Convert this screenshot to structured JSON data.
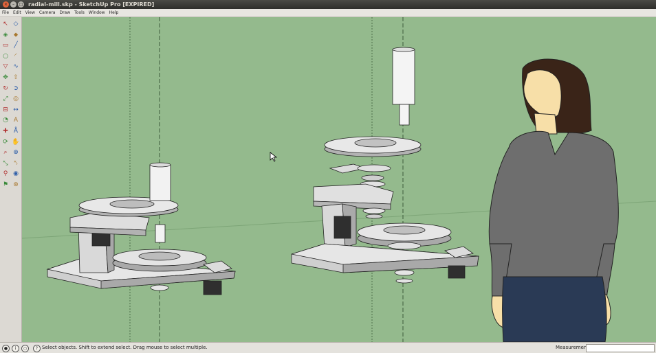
{
  "window": {
    "title": "radial-mill.skp - SketchUp Pro [EXPIRED]"
  },
  "menu": [
    "File",
    "Edit",
    "View",
    "Camera",
    "Draw",
    "Tools",
    "Window",
    "Help"
  ],
  "tools": [
    {
      "icon": "select-arrow-icon",
      "glyph": "↖"
    },
    {
      "icon": "eraser-icon",
      "glyph": "◇"
    },
    {
      "icon": "make-component-icon",
      "glyph": "◈"
    },
    {
      "icon": "paint-bucket-icon",
      "glyph": "⬥"
    },
    {
      "icon": "rectangle-icon",
      "glyph": "▭"
    },
    {
      "icon": "line-pencil-icon",
      "glyph": "╱"
    },
    {
      "icon": "circle-icon",
      "glyph": "○"
    },
    {
      "icon": "arc-icon",
      "glyph": "◜"
    },
    {
      "icon": "polygon-icon",
      "glyph": "▽"
    },
    {
      "icon": "freehand-icon",
      "glyph": "∿"
    },
    {
      "icon": "move-icon",
      "glyph": "✥"
    },
    {
      "icon": "push-pull-icon",
      "glyph": "⇧"
    },
    {
      "icon": "rotate-icon",
      "glyph": "↻"
    },
    {
      "icon": "follow-me-icon",
      "glyph": "➲"
    },
    {
      "icon": "scale-icon",
      "glyph": "⤢"
    },
    {
      "icon": "offset-icon",
      "glyph": "◎"
    },
    {
      "icon": "tape-measure-icon",
      "glyph": "⊟"
    },
    {
      "icon": "dimension-icon",
      "glyph": "↔"
    },
    {
      "icon": "protractor-icon",
      "glyph": "◔"
    },
    {
      "icon": "text-icon",
      "glyph": "A"
    },
    {
      "icon": "axes-icon",
      "glyph": "✚"
    },
    {
      "icon": "3d-text-icon",
      "glyph": "Å"
    },
    {
      "icon": "orbit-icon",
      "glyph": "⟳"
    },
    {
      "icon": "pan-icon",
      "glyph": "✋"
    },
    {
      "icon": "zoom-icon",
      "glyph": "⌕"
    },
    {
      "icon": "zoom-window-icon",
      "glyph": "⊕"
    },
    {
      "icon": "zoom-extents-icon",
      "glyph": "⤡"
    },
    {
      "icon": "previous-view-icon",
      "glyph": "⤣"
    },
    {
      "icon": "position-camera-icon",
      "glyph": "⚲"
    },
    {
      "icon": "look-around-icon",
      "glyph": "◉"
    },
    {
      "icon": "walk-icon",
      "glyph": "⚑"
    },
    {
      "icon": "section-plane-icon",
      "glyph": "⊛"
    }
  ],
  "statusbar": {
    "message": "Select objects. Shift to extend select. Drag mouse to select multiple.",
    "measurements_label": "Measurements",
    "measurements_value": ""
  }
}
